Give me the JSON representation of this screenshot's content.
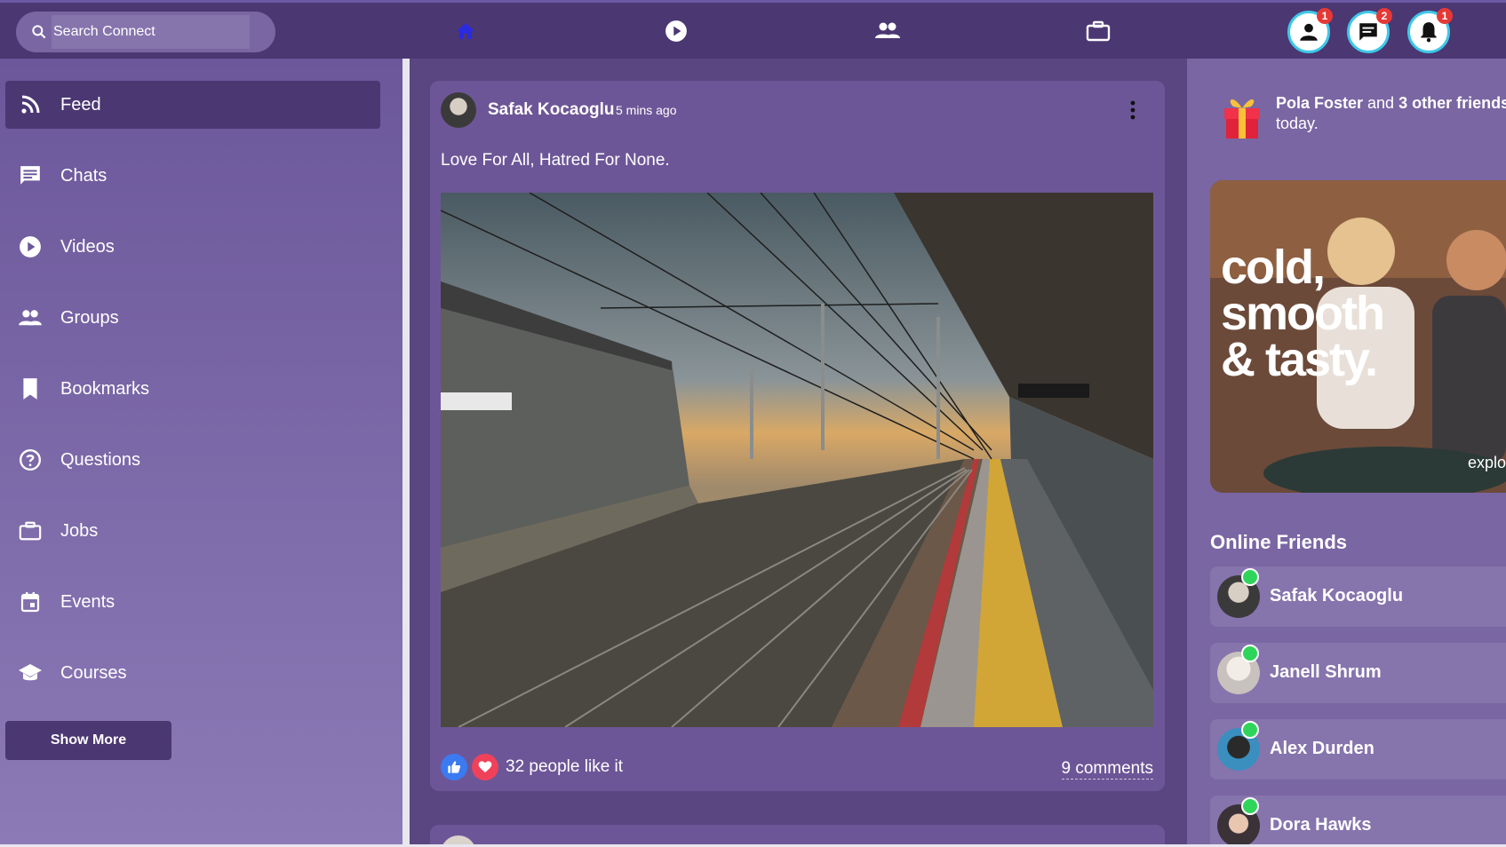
{
  "search": {
    "placeholder": "Search Connect"
  },
  "topbar": {
    "nav": [
      {
        "icon": "home-icon",
        "active": true
      },
      {
        "icon": "play-icon"
      },
      {
        "icon": "people-icon"
      },
      {
        "icon": "briefcase-icon"
      }
    ],
    "badges": {
      "profile": "1",
      "messages": "2",
      "notifications": "1"
    }
  },
  "sidebar": {
    "items": [
      {
        "label": "Feed",
        "icon": "rss-icon"
      },
      {
        "label": "Chats",
        "icon": "chat-icon"
      },
      {
        "label": "Videos",
        "icon": "play-circle-icon"
      },
      {
        "label": "Groups",
        "icon": "group-icon"
      },
      {
        "label": "Bookmarks",
        "icon": "bookmark-icon"
      },
      {
        "label": "Questions",
        "icon": "help-circle-icon"
      },
      {
        "label": "Jobs",
        "icon": "briefcase-icon"
      },
      {
        "label": "Events",
        "icon": "calendar-icon"
      },
      {
        "label": "Courses",
        "icon": "school-icon"
      }
    ],
    "show_more": "Show More"
  },
  "post": {
    "author": "Safak Kocaoglu",
    "time": "5 mins ago",
    "text": "Love For All, Hatred For None.",
    "likes": "32 people like it",
    "comments": "9 comments"
  },
  "right": {
    "birthday": {
      "name": "Pola Foster",
      "mid": " and ",
      "others": "3 other friends",
      "tail": "today."
    },
    "ad": {
      "line1": "cold,",
      "line2": "smooth",
      "line3": "& tasty.",
      "explore": "explo"
    },
    "online_title": "Online Friends",
    "friends": [
      {
        "name": "Safak Kocaoglu"
      },
      {
        "name": "Janell Shrum"
      },
      {
        "name": "Alex Durden"
      },
      {
        "name": "Dora Hawks"
      }
    ]
  },
  "colors": {
    "accent": "#4b3772",
    "online": "#2fd55a",
    "badge": "#e53935"
  }
}
